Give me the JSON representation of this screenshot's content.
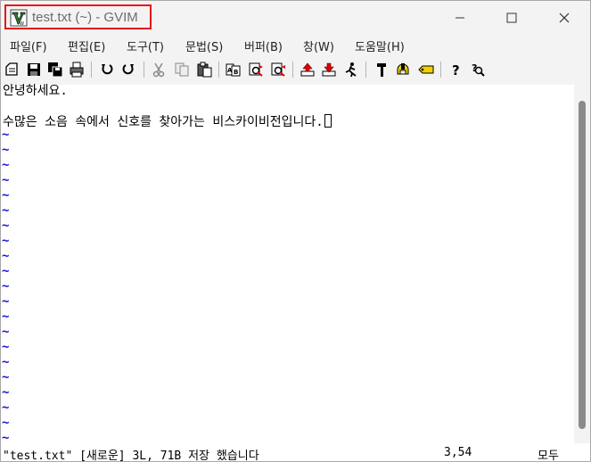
{
  "window": {
    "title": "test.txt (~) - GVIM",
    "icon": "gvim-icon"
  },
  "titlebar_buttons": [
    "minimize-icon",
    "maximize-icon",
    "close-icon"
  ],
  "menu": [
    {
      "label": "파일(F)"
    },
    {
      "label": "편집(E)"
    },
    {
      "label": "도구(T)"
    },
    {
      "label": "문법(S)"
    },
    {
      "label": "버퍼(B)"
    },
    {
      "label": "창(W)"
    },
    {
      "label": "도움말(H)"
    }
  ],
  "toolbar": [
    "open-icon",
    "save-icon",
    "save-all-icon",
    "print-icon",
    "undo-icon",
    "redo-icon",
    "cut-icon",
    "copy-icon",
    "paste-icon",
    "replace-icon",
    "find-next-icon",
    "find-prev-icon",
    "load-session-icon",
    "save-session-icon",
    "run-script-icon",
    "make-icon",
    "shell-icon",
    "tag-jump-icon",
    "help-icon",
    "help-search-icon"
  ],
  "editor": {
    "lines": [
      "안녕하세요.",
      "",
      "수많은 소음 속에서 신호를 찾아가는 비스카이비전입니다."
    ],
    "tilde": "~",
    "tilde_count": 21
  },
  "status": {
    "message": "\"test.txt\" [새로운] 3L, 71B 저장 했습니다",
    "position": "3,54",
    "percent": "모두"
  },
  "colors": {
    "tilde": "#1212d6",
    "highlight_box": "#e8101a",
    "scrollbar_thumb": "#8b8b8b"
  }
}
